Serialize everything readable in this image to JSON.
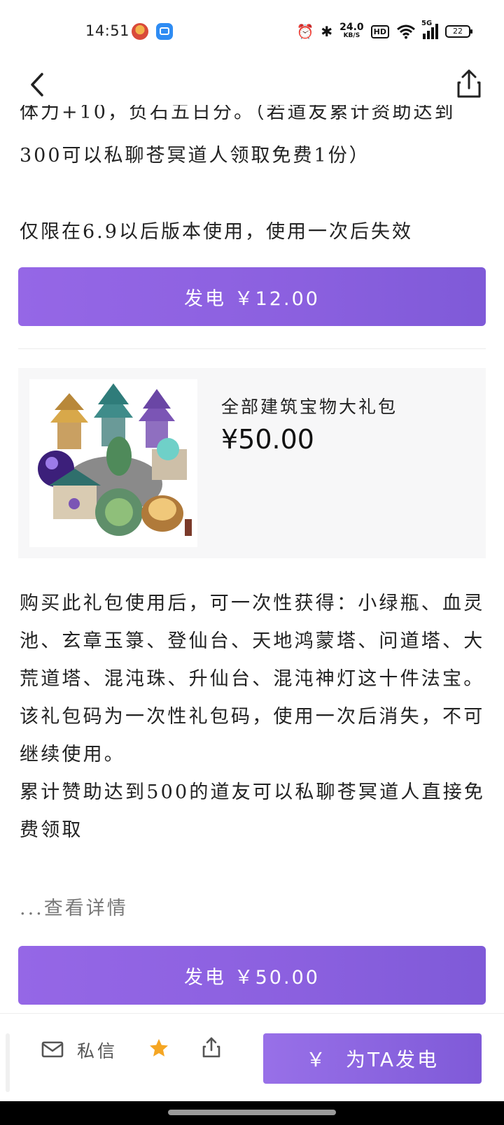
{
  "status_bar": {
    "time": "14:51",
    "network_speed_value": "24.0",
    "network_speed_unit": "KB/S",
    "hd_badge": "HD",
    "signal_tag": "5G",
    "battery": "22"
  },
  "content": {
    "partial_line_top": "体力+10，负石五日分。（若道友累计资助达到",
    "line_a": "300可以私聊苍冥道人领取免费1份）",
    "line_b": "仅限在6.9以后版本使用，使用一次后失效",
    "charge_button_1": "发电 ￥12.00"
  },
  "product": {
    "title": "全部建筑宝物大礼包",
    "price": "¥50.00",
    "description": [
      "购买此礼包使用后，可一次性获得：小绿瓶、血灵池、玄章玉箓、登仙台、天地鸿蒙塔、问道塔、大荒道塔、混沌珠、升仙台、混沌神灯这十件法宝。",
      "该礼包码为一次性礼包码，使用一次后消失，不可继续使用。",
      "累计赞助达到500的道友可以私聊苍冥道人直接免费领取"
    ],
    "view_more": "...查看详情",
    "charge_button_2": "发电 ￥50.00"
  },
  "bottom_bar": {
    "dm_label": "私信",
    "charge_symbol": "￥",
    "charge_label": "为TA发电"
  },
  "colors": {
    "accent_purple": "#8b60df",
    "star_orange": "#f5a623"
  }
}
